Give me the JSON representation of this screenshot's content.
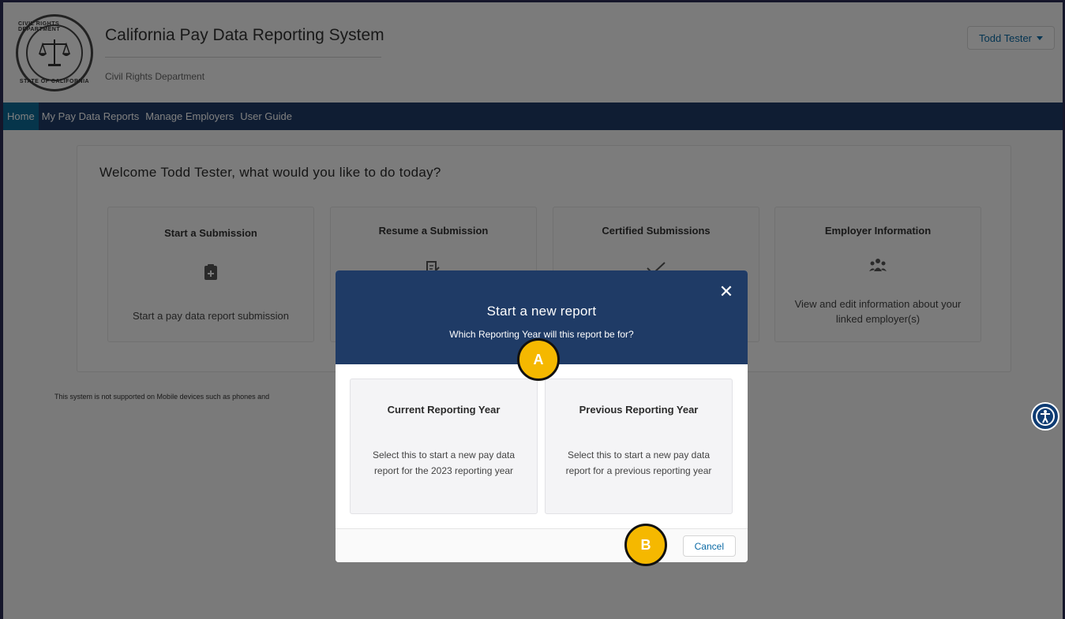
{
  "header": {
    "app_title": "California Pay Data Reporting System",
    "department": "Civil Rights Department",
    "seal_top": "CIVIL RIGHTS DEPARTMENT",
    "seal_bottom": "STATE OF CALIFORNIA",
    "user_menu": "Todd Tester"
  },
  "nav": {
    "items": [
      {
        "label": "Home",
        "active": true
      },
      {
        "label": "My Pay Data Reports"
      },
      {
        "label": "Manage Employers"
      },
      {
        "label": "User Guide"
      }
    ]
  },
  "main": {
    "welcome": "Welcome Todd Tester, what would you like to do today?",
    "tiles": [
      {
        "title": "Start a Submission",
        "icon": "clipboard-plus-icon",
        "desc": "Start a pay data report submission"
      },
      {
        "title": "Resume a Submission",
        "icon": "edit-document-icon",
        "desc": ""
      },
      {
        "title": "Certified Submissions",
        "icon": "checkmark-icon",
        "desc": ""
      },
      {
        "title": "Employer Information",
        "icon": "people-group-icon",
        "desc": "View and edit information about your linked employer(s)"
      }
    ],
    "notice": "This system is not supported on Mobile devices such as phones and"
  },
  "modal": {
    "title": "Start a new report",
    "subtitle": "Which Reporting Year will this report be for?",
    "close_glyph": "✕",
    "options": [
      {
        "title": "Current Reporting Year",
        "desc": "Select this to start a new pay data report for the 2023 reporting year"
      },
      {
        "title": "Previous Reporting Year",
        "desc": "Select this to start a new pay data report for a previous reporting year"
      }
    ],
    "cancel_label": "Cancel"
  },
  "markers": {
    "a": "A",
    "b": "B"
  },
  "colors": {
    "nav_bg": "#1f3b66",
    "nav_active": "#0d6a96",
    "link": "#0b6aa5",
    "marker": "#f5b800"
  }
}
